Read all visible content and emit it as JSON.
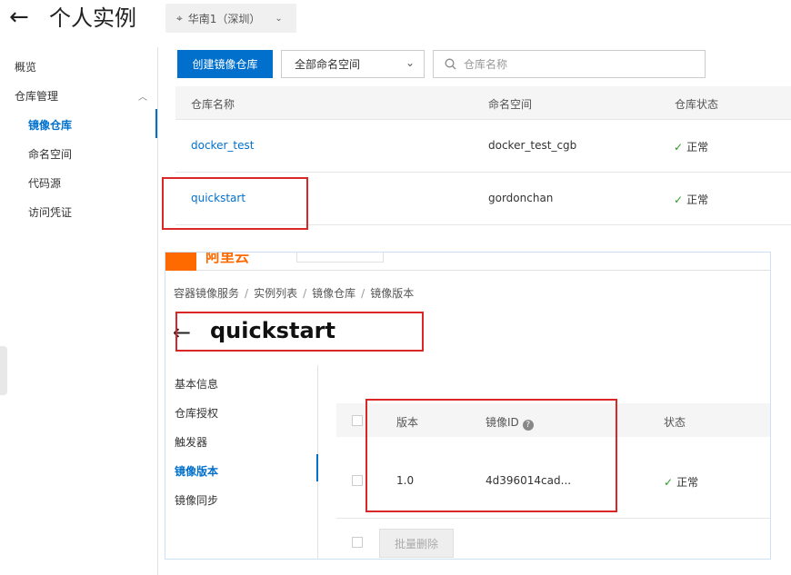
{
  "header": {
    "title": "个人实例",
    "region": "华南1（深圳）"
  },
  "sidebar": {
    "items": [
      {
        "label": "概览"
      },
      {
        "label": "仓库管理"
      },
      {
        "label": "镜像仓库"
      },
      {
        "label": "命名空间"
      },
      {
        "label": "代码源"
      },
      {
        "label": "访问凭证"
      }
    ]
  },
  "toolbar": {
    "create_label": "创建镜像仓库",
    "namespace_select": "全部命名空间",
    "search_placeholder": "仓库名称"
  },
  "repo_table": {
    "columns": [
      "仓库名称",
      "命名空间",
      "仓库状态"
    ],
    "rows": [
      {
        "name": "docker_test",
        "namespace": "docker_test_cgb",
        "status": "正常"
      },
      {
        "name": "quickstart",
        "namespace": "gordonchan",
        "status": "正常"
      }
    ]
  },
  "inset": {
    "logo": "阿里云",
    "breadcrumb": [
      "容器镜像服务",
      "实例列表",
      "镜像仓库",
      "镜像版本"
    ],
    "title": "quickstart",
    "nav": [
      {
        "label": "基本信息"
      },
      {
        "label": "仓库授权"
      },
      {
        "label": "触发器"
      },
      {
        "label": "镜像版本"
      },
      {
        "label": "镜像同步"
      }
    ],
    "version_table": {
      "columns": [
        "版本",
        "镜像ID",
        "状态"
      ],
      "rows": [
        {
          "version": "1.0",
          "image_id": "4d396014cad...",
          "status": "正常"
        }
      ]
    },
    "batch_delete_label": "批量删除"
  },
  "colors": {
    "accent": "#0070cc",
    "highlight_box": "#d92626",
    "brand_orange": "#ff6a00",
    "status_ok": "#2a9a2a"
  }
}
